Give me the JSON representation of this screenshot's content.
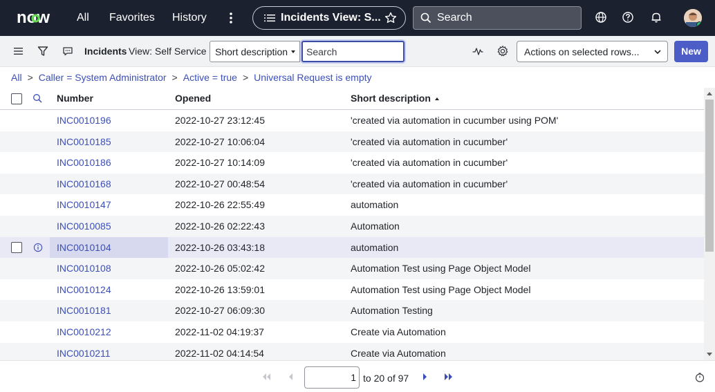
{
  "topnav": {
    "logo_text": "now",
    "links": [
      "All",
      "Favorites",
      "History"
    ],
    "context_pill": "Incidents View: S...",
    "search_placeholder": "Search"
  },
  "listbar": {
    "title": "Incidents",
    "view": "View: Self Service",
    "field_select": "Short description",
    "search_placeholder": "Search",
    "actions_select": "Actions on selected rows...",
    "new_label": "New"
  },
  "breadcrumb": {
    "items": [
      "All",
      "Caller = System Administrator",
      "Active = true",
      "Universal Request is empty"
    ],
    "separator": ">"
  },
  "table": {
    "columns": [
      "Number",
      "Opened",
      "Short description"
    ],
    "sorted_column": "Short description",
    "sort_direction": "ascending",
    "rows": [
      {
        "number": "INC0010196",
        "opened": "2022-10-27 23:12:45",
        "desc": "'created via automation in cucumber using POM'"
      },
      {
        "number": "INC0010185",
        "opened": "2022-10-27 10:06:04",
        "desc": "'created via automation in cucumber'"
      },
      {
        "number": "INC0010186",
        "opened": "2022-10-27 10:14:09",
        "desc": "'created via automation in cucumber'"
      },
      {
        "number": "INC0010168",
        "opened": "2022-10-27 00:48:54",
        "desc": "'created via automation in cucumber'"
      },
      {
        "number": "INC0010147",
        "opened": "2022-10-26 22:55:49",
        "desc": "automation"
      },
      {
        "number": "INC0010085",
        "opened": "2022-10-26 02:22:43",
        "desc": "Automation"
      },
      {
        "number": "INC0010104",
        "opened": "2022-10-26 03:43:18",
        "desc": "automation"
      },
      {
        "number": "INC0010108",
        "opened": "2022-10-26 05:02:42",
        "desc": "Automation Test using Page Object Model"
      },
      {
        "number": "INC0010124",
        "opened": "2022-10-26 13:59:01",
        "desc": "Automation Test using Page Object Model"
      },
      {
        "number": "INC0010181",
        "opened": "2022-10-27 06:09:30",
        "desc": "Automation Testing"
      },
      {
        "number": "INC0010212",
        "opened": "2022-11-02 04:19:37",
        "desc": "Create via Automation"
      },
      {
        "number": "INC0010211",
        "opened": "2022-11-02 04:14:54",
        "desc": "Create via Automation"
      }
    ],
    "hovered_row_number": "INC0010104"
  },
  "pager": {
    "page_value": "1",
    "range_text": "to 20 of 97"
  },
  "colors": {
    "nav_bg": "#1c2130",
    "link": "#3c4fb8",
    "primary_button": "#4c5dc7",
    "logo_accent": "#62d84e"
  }
}
